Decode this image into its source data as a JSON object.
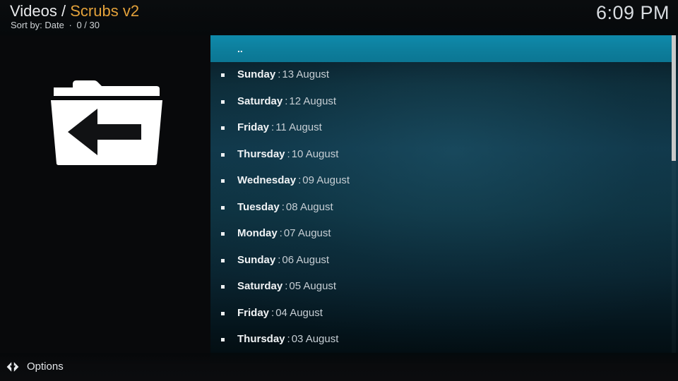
{
  "header": {
    "breadcrumb_root": "Videos",
    "breadcrumb_separator": "/",
    "breadcrumb_current": "Scrubs v2",
    "sort_label": "Sort by: Date",
    "separator_dot": "·",
    "counter": "0 / 30",
    "clock": "6:09 PM"
  },
  "icons": {
    "parent_folder": "folder-up-icon",
    "options": "left-right-arrows-icon"
  },
  "colors": {
    "accent_orange": "#e3a13a",
    "selection_teal": "#0d7e9c",
    "panel_dark": "#08090b",
    "text_primary": "#e7ebee",
    "text_secondary": "#c6ced4"
  },
  "list": {
    "selected_index": 0,
    "items": [
      {
        "marker": false,
        "day": "..",
        "colon": "",
        "date": ""
      },
      {
        "marker": true,
        "day": "Sunday",
        "colon": ":",
        "date": "13 August"
      },
      {
        "marker": true,
        "day": "Saturday",
        "colon": ":",
        "date": "12 August"
      },
      {
        "marker": true,
        "day": "Friday",
        "colon": ":",
        "date": "11 August"
      },
      {
        "marker": true,
        "day": "Thursday",
        "colon": ":",
        "date": "10 August"
      },
      {
        "marker": true,
        "day": "Wednesday",
        "colon": ":",
        "date": "09 August"
      },
      {
        "marker": true,
        "day": "Tuesday",
        "colon": ":",
        "date": "08 August"
      },
      {
        "marker": true,
        "day": "Monday",
        "colon": ":",
        "date": "07 August"
      },
      {
        "marker": true,
        "day": "Sunday",
        "colon": ":",
        "date": "06 August"
      },
      {
        "marker": true,
        "day": "Saturday",
        "colon": ":",
        "date": "05 August"
      },
      {
        "marker": true,
        "day": "Friday",
        "colon": ":",
        "date": "04 August"
      },
      {
        "marker": true,
        "day": "Thursday",
        "colon": ":",
        "date": "03 August"
      }
    ]
  },
  "bottom_bar": {
    "options_label": "Options"
  }
}
